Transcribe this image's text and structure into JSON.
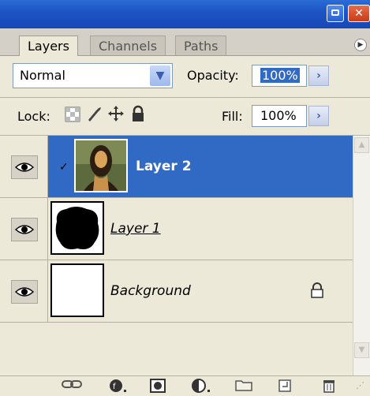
{
  "tabs": [
    {
      "label": "Layers"
    },
    {
      "label": "Channels"
    },
    {
      "label": "Paths"
    }
  ],
  "blend_mode": {
    "value": "Normal"
  },
  "opacity": {
    "label": "Opacity:",
    "value": "100%"
  },
  "lock": {
    "label": "Lock:"
  },
  "fill": {
    "label": "Fill:",
    "value": "100%"
  },
  "layers": [
    {
      "name": "Layer 2",
      "selected": true,
      "visible": true
    },
    {
      "name": "Layer 1",
      "selected": false,
      "visible": true
    },
    {
      "name": "Background",
      "selected": false,
      "visible": true,
      "locked": true
    }
  ],
  "icons": {
    "link": "link-icon",
    "fx": "layer-style-icon",
    "mask": "add-mask-icon",
    "adjustment": "adjustment-layer-icon",
    "group": "folder-icon",
    "new": "new-layer-icon",
    "delete": "trash-icon"
  },
  "colors": {
    "selection": "#316ac5",
    "titlebar": "#1d55c4",
    "panel": "#ece9d8"
  }
}
